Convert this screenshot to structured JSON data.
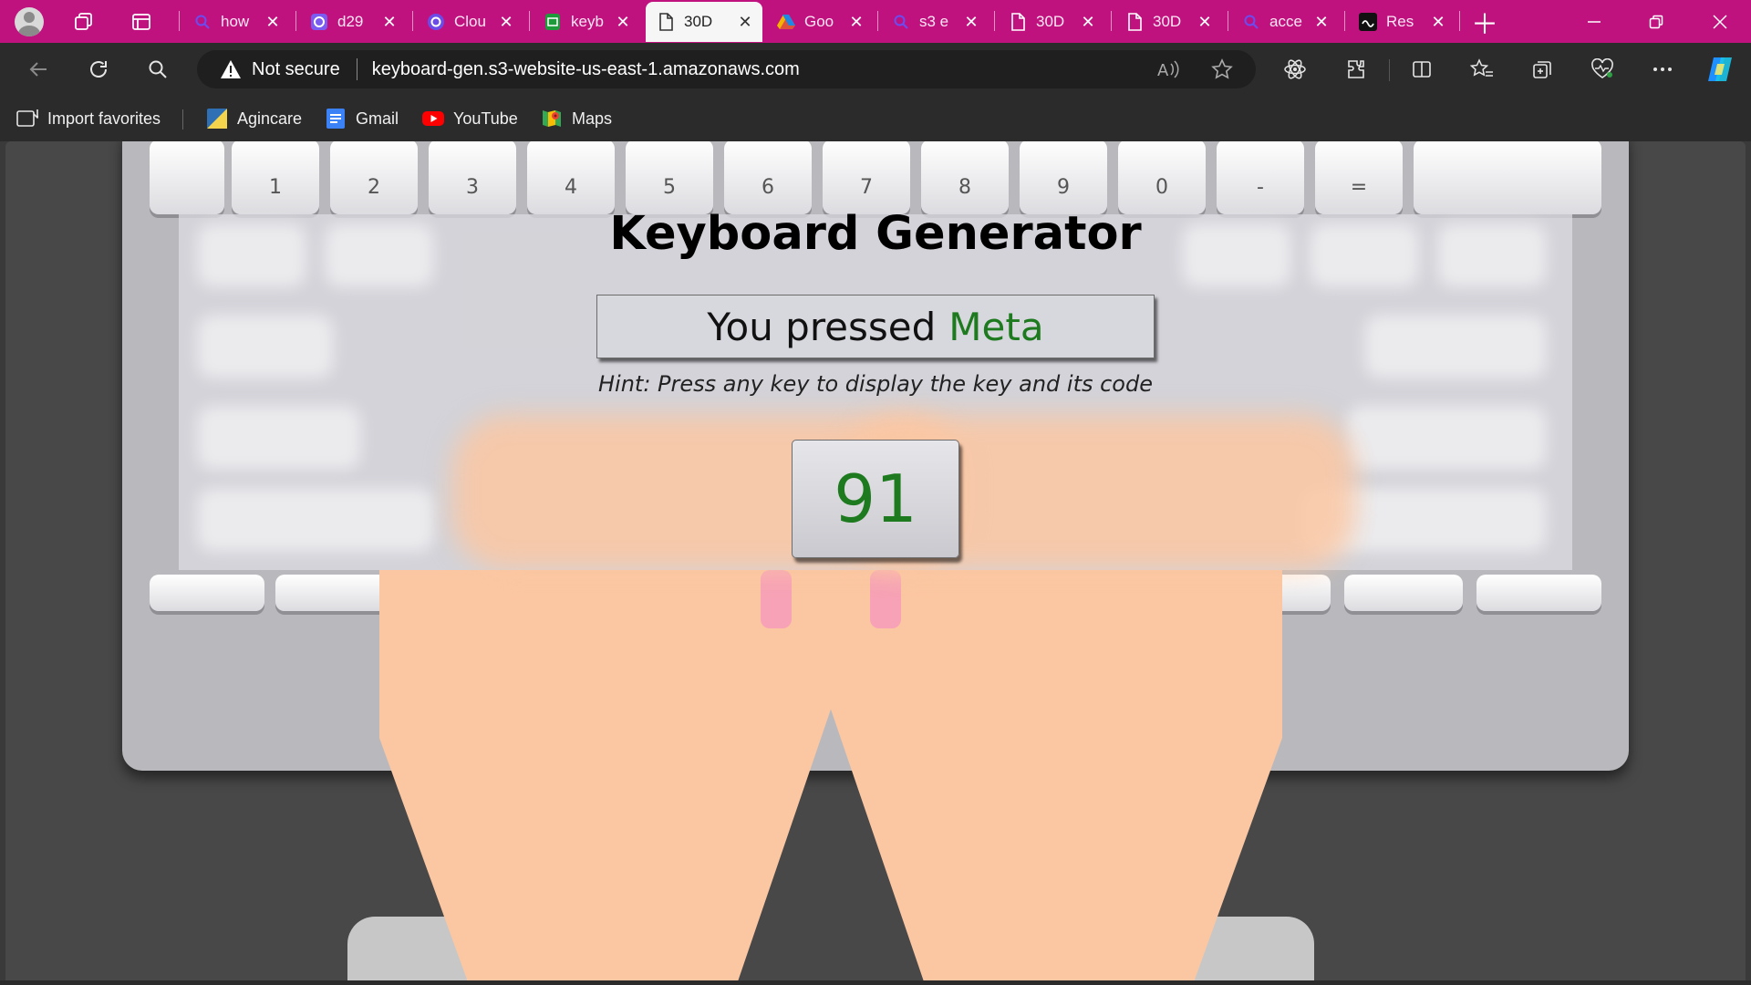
{
  "browser": {
    "tabs": [
      {
        "title": "how",
        "icon": "search-icon"
      },
      {
        "title": "d29",
        "icon": "app-icon"
      },
      {
        "title": "Clou",
        "icon": "cloud-app-icon"
      },
      {
        "title": "keyb",
        "icon": "sheet-icon"
      },
      {
        "title": "30D",
        "icon": "page-icon",
        "active": true
      },
      {
        "title": "Goo",
        "icon": "drive-icon"
      },
      {
        "title": "s3 e",
        "icon": "search-icon"
      },
      {
        "title": "30D",
        "icon": "page-icon"
      },
      {
        "title": "30D",
        "icon": "page-icon"
      },
      {
        "title": "acce",
        "icon": "search-icon"
      },
      {
        "title": "Res",
        "icon": "wave-icon"
      }
    ],
    "address": {
      "security_label": "Not secure",
      "url": "keyboard-gen.s3-website-us-east-1.amazonaws.com"
    },
    "favorites": [
      {
        "label": "Import favorites"
      },
      {
        "label": "Agincare"
      },
      {
        "label": "Gmail"
      },
      {
        "label": "YouTube"
      },
      {
        "label": "Maps"
      }
    ],
    "accent_color": "#c0127f"
  },
  "page": {
    "title": "Keyboard Generator",
    "pressed_prefix": "You pressed",
    "pressed_key": "Meta",
    "hint": "Hint: Press any key to display the key and its code",
    "key_code": "91",
    "highlight_color": "#1e7a1e",
    "keyboard_top_row": [
      "",
      "1",
      "2",
      "3",
      "4",
      "5",
      "6",
      "7",
      "8",
      "9",
      "0",
      "-",
      "=",
      ""
    ]
  }
}
